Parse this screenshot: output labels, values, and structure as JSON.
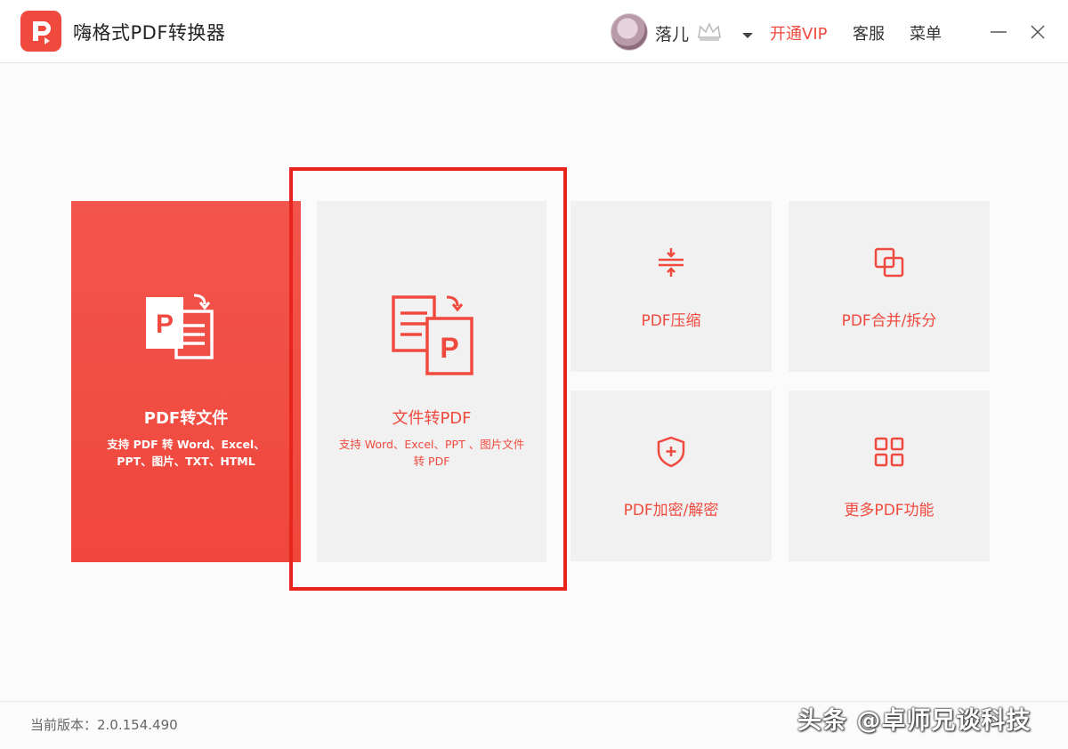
{
  "app": {
    "title": "嗨格式PDF转换器"
  },
  "user": {
    "name": "落儿"
  },
  "header": {
    "vip_label": "开通VIP",
    "service_label": "客服",
    "menu_label": "菜单"
  },
  "tiles": {
    "pdf_to_file": {
      "title": "PDF转文件",
      "description": "支持 PDF 转 Word、Excel、PPT、图片、TXT、HTML"
    },
    "file_to_pdf": {
      "title": "文件转PDF",
      "description": "支持 Word、Excel、PPT 、图片文件转 PDF"
    },
    "compress": {
      "title": "PDF压缩"
    },
    "merge_split": {
      "title": "PDF合并/拆分"
    },
    "encrypt": {
      "title": "PDF加密/解密"
    },
    "more": {
      "title": "更多PDF功能"
    }
  },
  "footer": {
    "version": "当前版本：2.0.154.490"
  },
  "watermark": {
    "text": "头条 @卓师兄谈科技"
  },
  "colors": {
    "accent": "#f04a3e",
    "highlight_box": "#e8251d",
    "tile_bg": "#f1f1f2"
  },
  "icons": {
    "logo": "pdf-logo-icon",
    "crown": "crown-icon",
    "dropdown": "caret-down-icon",
    "minimize": "minimize-icon",
    "close": "close-icon",
    "pdf_to_file": "pdf-to-document-icon",
    "file_to_pdf": "document-to-pdf-icon",
    "compress": "compress-icon",
    "merge_split": "merge-squares-icon",
    "encrypt": "shield-plus-icon",
    "more": "grid-icon"
  }
}
